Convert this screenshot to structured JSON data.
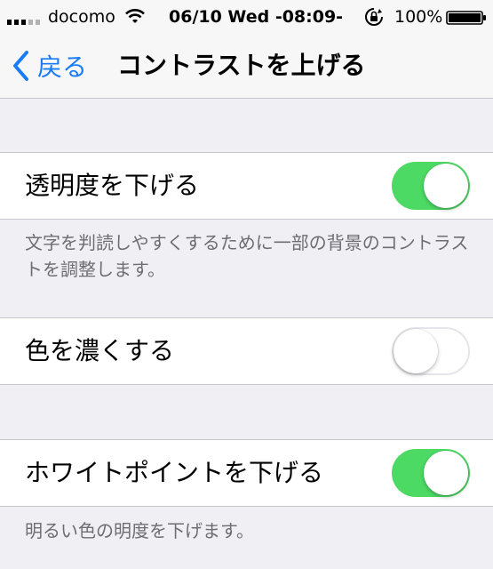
{
  "status_bar": {
    "carrier": "docomo",
    "time": "06/10 Wed -08:09-",
    "battery_percent": "100%",
    "signal_bars_filled": 3,
    "signal_bars_total": 5,
    "icons": [
      "wifi-icon",
      "rotation-lock-icon",
      "battery-icon"
    ]
  },
  "nav": {
    "back_label": "戻る",
    "title": "コントラストを上げる"
  },
  "settings": [
    {
      "label": "透明度を下げる",
      "enabled": true,
      "footer": "文字を判読しやすくするために一部の背景のコントラストを調整します。"
    },
    {
      "label": "色を濃くする",
      "enabled": false,
      "footer": ""
    },
    {
      "label": "ホワイトポイントを下げる",
      "enabled": true,
      "footer": "明るい色の明度を下げます。"
    }
  ],
  "colors": {
    "accent": "#1a7cf5",
    "toggle_on": "#4cd964",
    "background": "#efeff4",
    "footer_text": "#6d6d72"
  }
}
